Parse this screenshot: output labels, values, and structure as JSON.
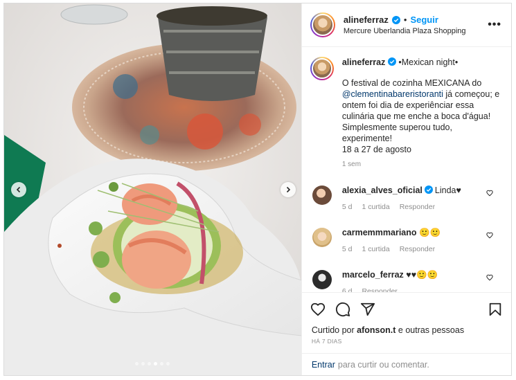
{
  "post": {
    "username": "alineferraz",
    "follow_label": "Seguir",
    "separator": "•",
    "location": "Mercure Uberlandia Plaza Shopping",
    "more_label": "•••"
  },
  "caption": {
    "username": "alineferraz",
    "title": "•Mexican night•",
    "text_before": "O festival de cozinha MEXICANA do",
    "mention": "@clementinabareristoranti",
    "text_after": "já começou; e ontem foi dia de experiênciar essa culinária que me enche a boca d'água! Simplesmente superou tudo, experimente!\n18 a 27 de agosto",
    "time": "1 sem"
  },
  "comments": [
    {
      "username": "alexia_alves_oficial",
      "text": "Linda♥",
      "age": "5 d",
      "likes": "1 curtida",
      "reply": "Responder"
    },
    {
      "username": "carmemmmariano",
      "text": "🙂🙂",
      "age": "5 d",
      "likes": "1 curtida",
      "reply": "Responder"
    },
    {
      "username": "marcelo_ferraz",
      "text": "♥♥🙂🙂",
      "age": "6 d",
      "likes": "",
      "reply": "Responder"
    }
  ],
  "likes": {
    "prefix": "Curtido por",
    "user": "afonson.t",
    "suffix": "e outras pessoas",
    "date": "HÁ 7 DIAS"
  },
  "add_comment": {
    "login": "Entrar",
    "text": "para curtir ou comentar."
  },
  "carousel": {
    "count": 6,
    "active_index": 3
  },
  "colors": {
    "accent": "#0095f6",
    "link": "#00376b",
    "muted": "#8e8e8e"
  },
  "icons": [
    "verified-badge-icon",
    "heart-icon",
    "comment-icon",
    "share-icon",
    "bookmark-icon",
    "chevron-left-icon",
    "chevron-right-icon",
    "more-icon"
  ]
}
